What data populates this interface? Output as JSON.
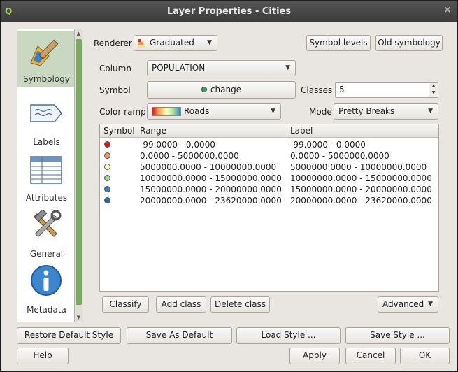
{
  "window": {
    "title": "Layer Properties - Cities",
    "app_icon": "Q",
    "close_glyph": "×"
  },
  "sidebar": {
    "items": [
      {
        "label": "Symbology",
        "icon": "paintbrush-icon",
        "selected": true
      },
      {
        "label": "Labels",
        "icon": "label-tag-icon",
        "selected": false
      },
      {
        "label": "Attributes",
        "icon": "table-icon",
        "selected": false
      },
      {
        "label": "General",
        "icon": "tools-icon",
        "selected": false
      },
      {
        "label": "Metadata",
        "icon": "info-icon",
        "selected": false
      }
    ]
  },
  "renderer": {
    "label": "Renderer",
    "value": "Graduated",
    "symbol_levels": "Symbol levels",
    "old_symbology": "Old symbology"
  },
  "form": {
    "column_label": "Column",
    "column_value": "POPULATION",
    "symbol_label": "Symbol",
    "symbol_button": "change",
    "classes_label": "Classes",
    "classes_value": "5",
    "color_ramp_label": "Color ramp",
    "color_ramp_value": "Roads",
    "mode_label": "Mode",
    "mode_value": "Pretty Breaks"
  },
  "table": {
    "headers": {
      "symbol": "Symbol",
      "range": "Range",
      "label": "Label"
    },
    "rows": [
      {
        "color": "#d7191c",
        "range": "-99.0000 - 0.0000",
        "label": "-99.0000 - 0.0000"
      },
      {
        "color": "#f29e4c",
        "range": "0.0000 - 5000000.0000",
        "label": "0.0000 - 5000000.0000"
      },
      {
        "color": "#ffffbf",
        "range": "5000000.0000 - 10000000.0000",
        "label": "5000000.0000 - 10000000.0000"
      },
      {
        "color": "#9fd59a",
        "range": "10000000.0000 - 15000000.0000",
        "label": "10000000.0000 - 15000000.0000"
      },
      {
        "color": "#3c84b8",
        "range": "15000000.0000 - 20000000.0000",
        "label": "15000000.0000 - 20000000.0000"
      },
      {
        "color": "#2b6aa3",
        "range": "20000000.0000 - 23620000.0000",
        "label": "20000000.0000 - 23620000.0000"
      }
    ]
  },
  "class_buttons": {
    "classify": "Classify",
    "add_class": "Add class",
    "delete_class": "Delete class",
    "advanced": "Advanced"
  },
  "style_buttons": {
    "restore_default": "Restore Default Style",
    "save_as_default": "Save As Default",
    "load_style": "Load Style ...",
    "save_style": "Save Style ..."
  },
  "footer": {
    "help": "Help",
    "apply": "Apply",
    "cancel": "Cancel",
    "ok": "OK"
  },
  "colors": {
    "ramp": [
      "#d7191c",
      "#fdae61",
      "#ffffbf",
      "#abdda4",
      "#2b83ba"
    ],
    "sidebar_selected": "#c9d8c1",
    "scroll_thumb": "#7ea86a"
  }
}
